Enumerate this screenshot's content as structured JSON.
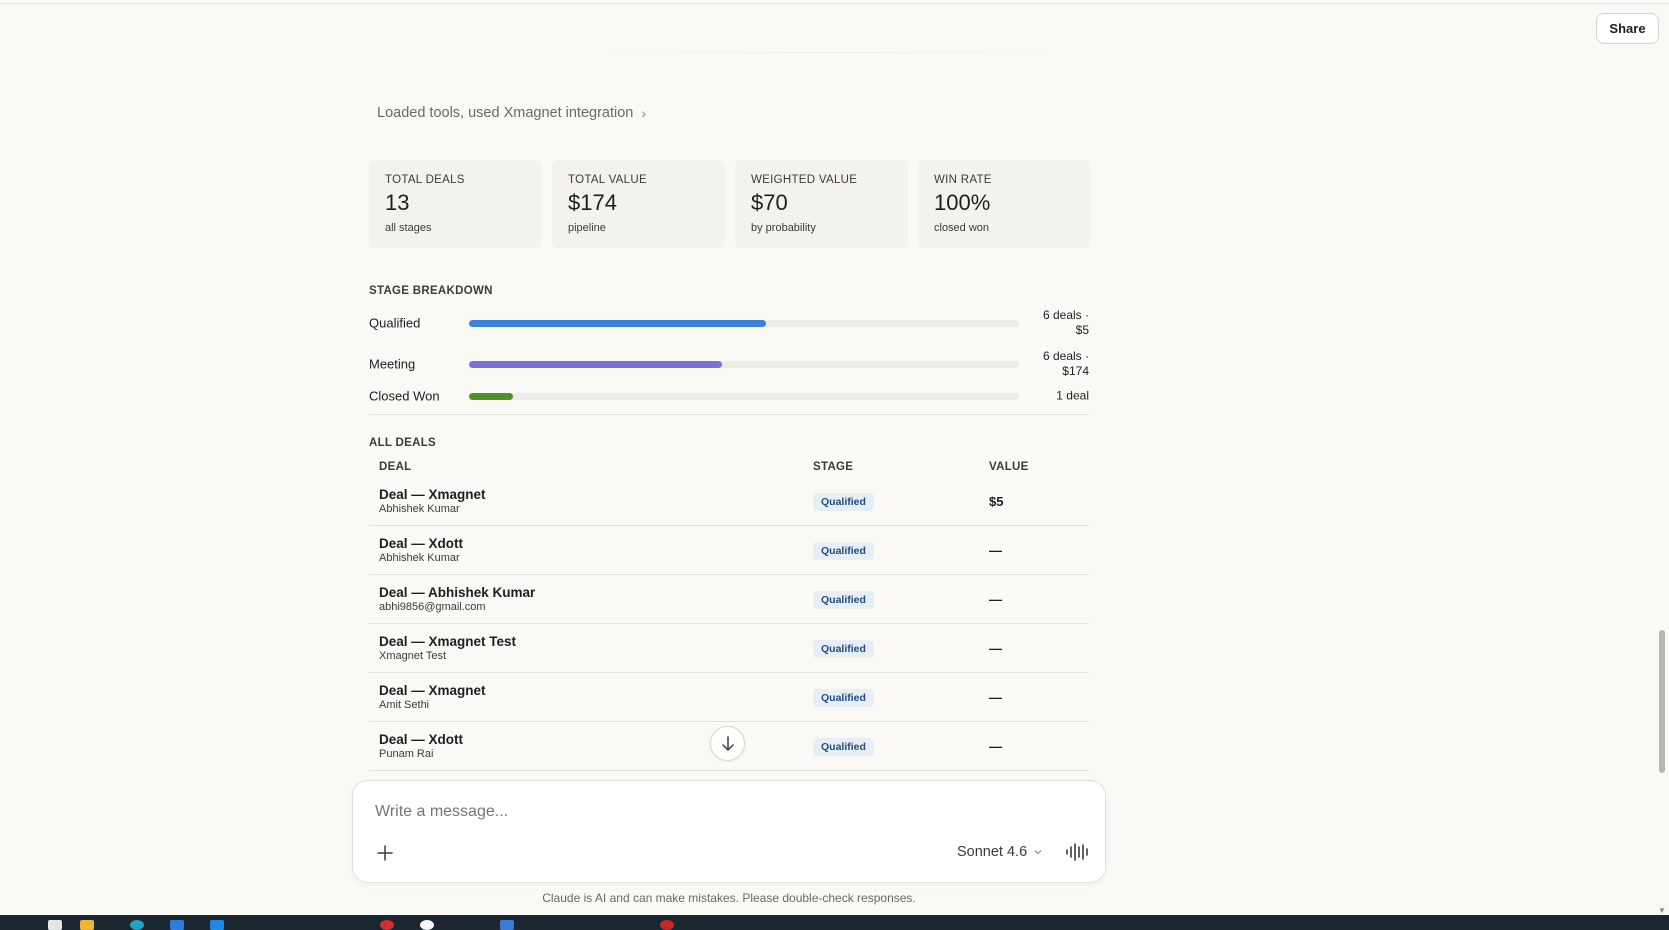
{
  "header": {
    "share_label": "Share"
  },
  "tools_line": {
    "text": "Loaded tools, used Xmagnet integration",
    "chevron": "›"
  },
  "stats": [
    {
      "label": "TOTAL DEALS",
      "value": "13",
      "sub": "all stages"
    },
    {
      "label": "TOTAL VALUE",
      "value": "$174",
      "sub": "pipeline"
    },
    {
      "label": "WEIGHTED VALUE",
      "value": "$70",
      "sub": "by probability"
    },
    {
      "label": "WIN RATE",
      "value": "100%",
      "sub": "closed won"
    }
  ],
  "stage_breakdown": {
    "title": "STAGE BREAKDOWN",
    "stages": [
      {
        "name": "Qualified",
        "count_line1": "6 deals ·",
        "count_line2": "$5",
        "fill": 0.54,
        "color": "#3b82d9"
      },
      {
        "name": "Meeting",
        "count_line1": "6 deals ·",
        "count_line2": "$174",
        "fill": 0.46,
        "color": "#7b6fd8"
      },
      {
        "name": "Closed Won",
        "count_line1": "1 deal",
        "count_line2": "",
        "fill": 0.08,
        "color": "#4e9128"
      }
    ]
  },
  "all_deals": {
    "title": "ALL DEALS",
    "columns": [
      "DEAL",
      "STAGE",
      "VALUE"
    ],
    "rows": [
      {
        "name": "Deal — Xmagnet",
        "sub": "Abhishek Kumar",
        "stage": "Qualified",
        "value": "$5"
      },
      {
        "name": "Deal — Xdott",
        "sub": "Abhishek Kumar",
        "stage": "Qualified",
        "value": "—"
      },
      {
        "name": "Deal — Abhishek Kumar",
        "sub": "abhi9856@gmail.com",
        "stage": "Qualified",
        "value": "—"
      },
      {
        "name": "Deal — Xmagnet Test",
        "sub": "Xmagnet Test",
        "stage": "Qualified",
        "value": "—"
      },
      {
        "name": "Deal — Xmagnet",
        "sub": "Amit Sethi",
        "stage": "Qualified",
        "value": "—"
      },
      {
        "name": "Deal — Xdott",
        "sub": "Punam Rai",
        "stage": "Qualified",
        "value": "—"
      }
    ]
  },
  "composer": {
    "placeholder": "Write a message...",
    "model": "Sonnet 4.6",
    "plus_icon": "plus-icon",
    "voice_icon": "voice-waveform-icon"
  },
  "disclaimer": "Claude is AI and can make mistakes. Please double-check responses.",
  "colors": {
    "badge_bg": "#e8eef5",
    "badge_text": "#1e4c84",
    "page_bg": "#faf9f5"
  }
}
